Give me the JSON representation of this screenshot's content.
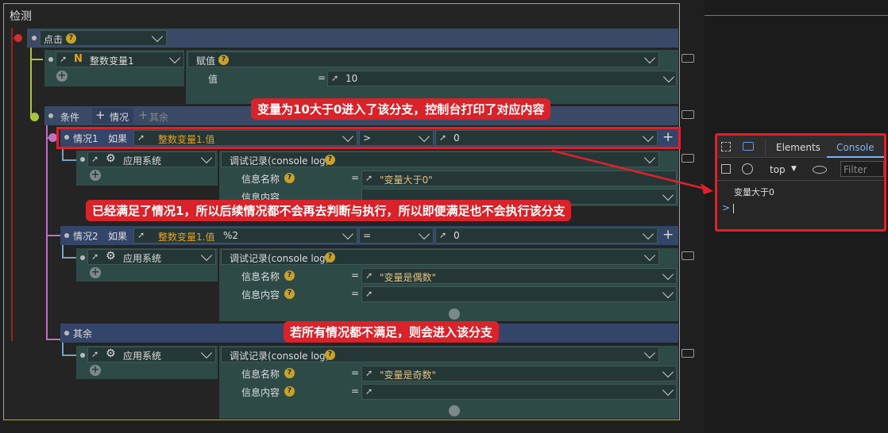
{
  "title": "检测",
  "click_node": {
    "label": "点击"
  },
  "var_node": {
    "label": "整数变量1",
    "type_glyph": "N"
  },
  "assign": {
    "label": "赋值",
    "value_label": "值",
    "eq": "=",
    "value": "10"
  },
  "cond": {
    "label": "条件",
    "case_btn": "情况",
    "else_btn": "其余"
  },
  "case1": {
    "label": "情况1",
    "if": "如果",
    "var": "整数变量1.值",
    "op": ">",
    "value": "0"
  },
  "case2": {
    "label": "情况2",
    "if": "如果",
    "var": "整数变量1.值",
    "extra": "%2",
    "op": "=",
    "value": "0"
  },
  "else": {
    "label": "其余"
  },
  "app": {
    "label": "应用系统"
  },
  "log": {
    "label": "调试记录(console log)",
    "name_label": "信息名称",
    "content_label": "信息内容",
    "eq": "="
  },
  "log_values": {
    "c1_name": "\"变量大于0\"",
    "c2_name": "\"变量是偶数\"",
    "else_name": "\"变量是奇数\""
  },
  "annotations": {
    "a1": "变量为10大于0进入了该分支，控制台打印了对应内容",
    "a2": "已经满足了情况1，所以后续情况都不会再去判断与执行，所以即便满足也不会执行该分支",
    "a3": "若所有情况都不满足，则会进入该分支"
  },
  "devtools": {
    "tabs": [
      "Elements",
      "Console"
    ],
    "context": "top",
    "filter_placeholder": "Filter",
    "log_output": "变量大于0",
    "prompt": ">"
  }
}
